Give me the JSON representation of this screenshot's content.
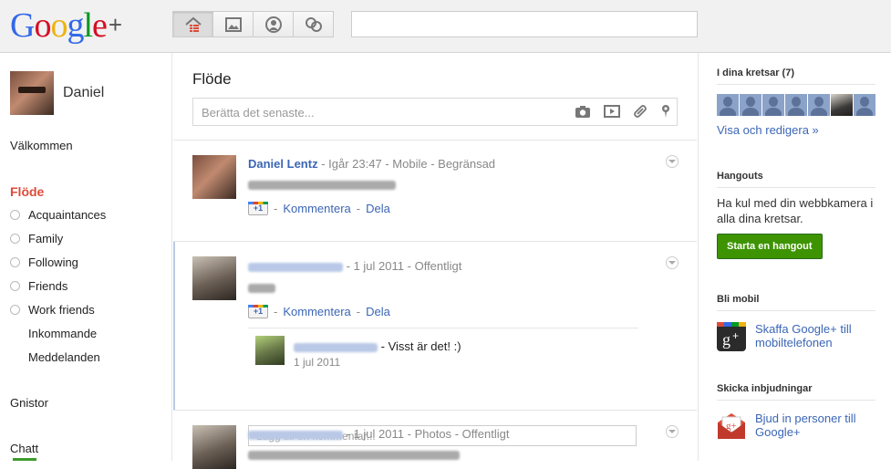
{
  "topbar": {
    "logo_letters": [
      "G",
      "o",
      "o",
      "g",
      "l",
      "e"
    ],
    "logo_colors": [
      "#3369e8",
      "#d50f25",
      "#eeb211",
      "#3369e8",
      "#009925",
      "#d50f25"
    ],
    "logo_plus": "+",
    "nav": [
      {
        "name": "home-icon",
        "active": true
      },
      {
        "name": "photos-icon",
        "active": false
      },
      {
        "name": "profile-icon",
        "active": false
      },
      {
        "name": "circles-icon",
        "active": false
      }
    ],
    "search_value": ""
  },
  "left": {
    "username": "Daniel",
    "welcome": "Välkommen",
    "stream": "Flöde",
    "circles": [
      "Acquaintances",
      "Family",
      "Following",
      "Friends",
      "Work friends"
    ],
    "incoming": "Inkommande",
    "notifications": "Meddelanden",
    "sparks": "Gnistor",
    "chat": "Chatt"
  },
  "main": {
    "title": "Flöde",
    "share_placeholder": "Berätta det senaste...",
    "posts": [
      {
        "author": "Daniel Lentz",
        "time": "Igår 23:47",
        "via": "Mobile",
        "visibility": "Begränsad",
        "comment_label": "Kommentera",
        "share_label": "Dela",
        "plusone": "+1"
      },
      {
        "time": "1 jul 2011",
        "visibility": "Offentligt",
        "comment_label": "Kommentera",
        "share_label": "Dela",
        "plusone": "+1",
        "comment": {
          "text": "- Visst är det! :)",
          "date": "1 jul 2011"
        },
        "add_comment_placeholder": "Lägg till en kommentar..."
      },
      {
        "time": "1 jul 2011",
        "type": "Photos",
        "visibility": "Offentligt"
      }
    ]
  },
  "right": {
    "circles_title": "I dina kretsar (7)",
    "circles_link": "Visa och redigera »",
    "hangouts_title": "Hangouts",
    "hangouts_text": "Ha kul med din webbkamera i alla dina kretsar.",
    "hangouts_button": "Starta en hangout",
    "mobile_title": "Bli mobil",
    "mobile_link": "Skaffa Google+ till mobiltelefonen",
    "invite_title": "Skicka inbjudningar",
    "invite_link": "Bjud in personer till Google+"
  },
  "colors": {
    "accent_red": "#dd4b39",
    "link_blue": "#3b66b5",
    "button_green": "#3d9400"
  }
}
